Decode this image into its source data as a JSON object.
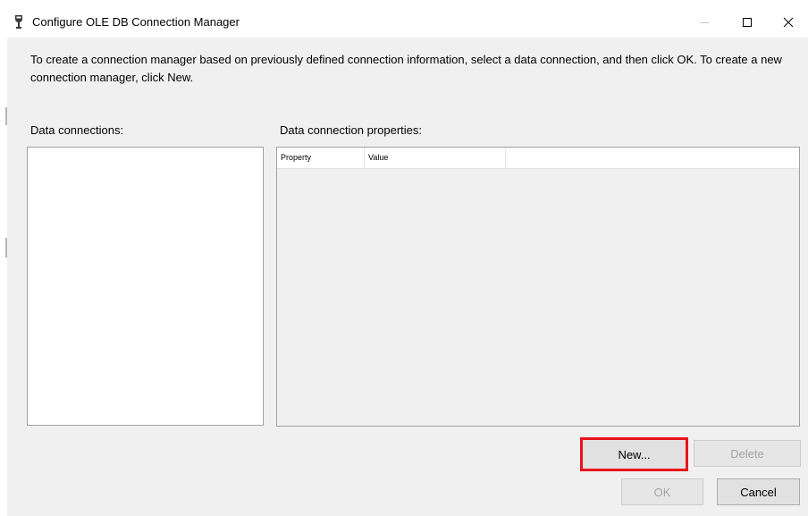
{
  "window": {
    "title": "Configure OLE DB Connection Manager",
    "icon": "connection-plug-icon",
    "controls": [
      "minimize-icon",
      "maximize-icon",
      "close-icon"
    ]
  },
  "intro_text": "To create a connection manager based on previously defined connection information, select a data connection, and then click OK. To create a new connection manager, click New.",
  "data_connections": {
    "label": "Data connections:",
    "items": []
  },
  "properties": {
    "label": "Data connection properties:",
    "columns": [
      "Property",
      "Value"
    ],
    "rows": []
  },
  "buttons": {
    "new": "New...",
    "delete": "Delete",
    "ok": "OK",
    "cancel": "Cancel"
  },
  "colors": {
    "dialog_background": "#f0f0f0",
    "highlight_outline": "#e8141b",
    "disabled_text": "#a3a3a3"
  }
}
